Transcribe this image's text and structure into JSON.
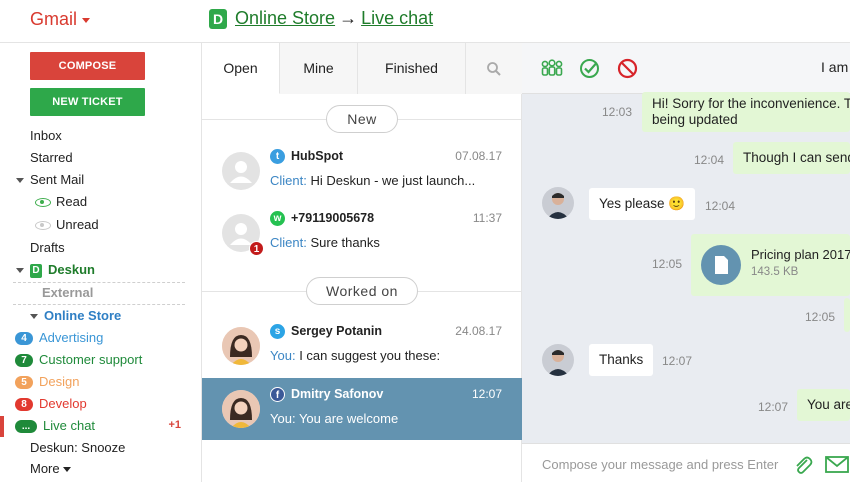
{
  "header": {
    "app_title": "Gmail",
    "crumb_store": "Online Store",
    "crumb_arrow": "→",
    "crumb_chat": "Live chat"
  },
  "sidebar": {
    "compose": "COMPOSE",
    "new_ticket": "NEW TICKET",
    "inbox": "Inbox",
    "starred": "Starred",
    "sent_mail": "Sent Mail",
    "read": "Read",
    "unread": "Unread",
    "drafts": "Drafts",
    "deskun": "Deskun",
    "external": "External",
    "online_store": "Online Store",
    "labels": [
      {
        "badge": "4",
        "label": "Advertising",
        "color": "#3a96d6"
      },
      {
        "badge": "7",
        "label": "Customer support",
        "color": "#1f8a3a"
      },
      {
        "badge": "5",
        "label": "Design",
        "color": "#f2a25c"
      },
      {
        "badge": "8",
        "label": "Develop",
        "color": "#e2392f"
      },
      {
        "badge": "...",
        "label": "Live chat",
        "color": "#1f8a3a",
        "count": "+1"
      }
    ],
    "snooze": "Deskun: Snooze",
    "more": "More"
  },
  "list": {
    "tabs": [
      "Open",
      "Mine",
      "Finished"
    ],
    "group_new": "New",
    "group_worked": "Worked on",
    "items": [
      {
        "name": "HubSpot",
        "date": "07.08.17",
        "who": "Client:",
        "text": "Hi Deskun - we just launch...",
        "source": "twitter"
      },
      {
        "name": "+79119005678",
        "date": "11:37",
        "who": "Client:",
        "text": "Sure thanks",
        "source": "whatsapp",
        "unread": "1"
      },
      {
        "name": "Sergey Potanin",
        "date": "24.08.17",
        "who": "You:",
        "text": "I can suggest you these:",
        "source": "skype"
      },
      {
        "name": "Dmitry Safonov",
        "date": "12:07",
        "who": "You:",
        "text": "You are welcome",
        "source": "facebook"
      }
    ]
  },
  "chat": {
    "status": "I am",
    "messages": [
      {
        "text": "Hi! Sorry for the inconvenience. Th",
        "text2": "being updated",
        "time": "12:03"
      },
      {
        "text": "Though I can send",
        "time": "12:04"
      },
      {
        "text": "Yes please 🙂",
        "time": "12:04"
      },
      {
        "file_name": "Pricing plan 2017",
        "file_size": "143.5 KB",
        "time": "12:05"
      },
      {
        "time": "12:05"
      },
      {
        "text": "Thanks",
        "time": "12:07"
      },
      {
        "text": "You are",
        "time": "12:07"
      }
    ],
    "composer_placeholder": "Compose your message and press Enter"
  },
  "colors": {
    "accent_green": "#2ea84a",
    "accent_red": "#d9443b",
    "selected_row": "#6393b0",
    "link_blue": "#3c86c4"
  }
}
